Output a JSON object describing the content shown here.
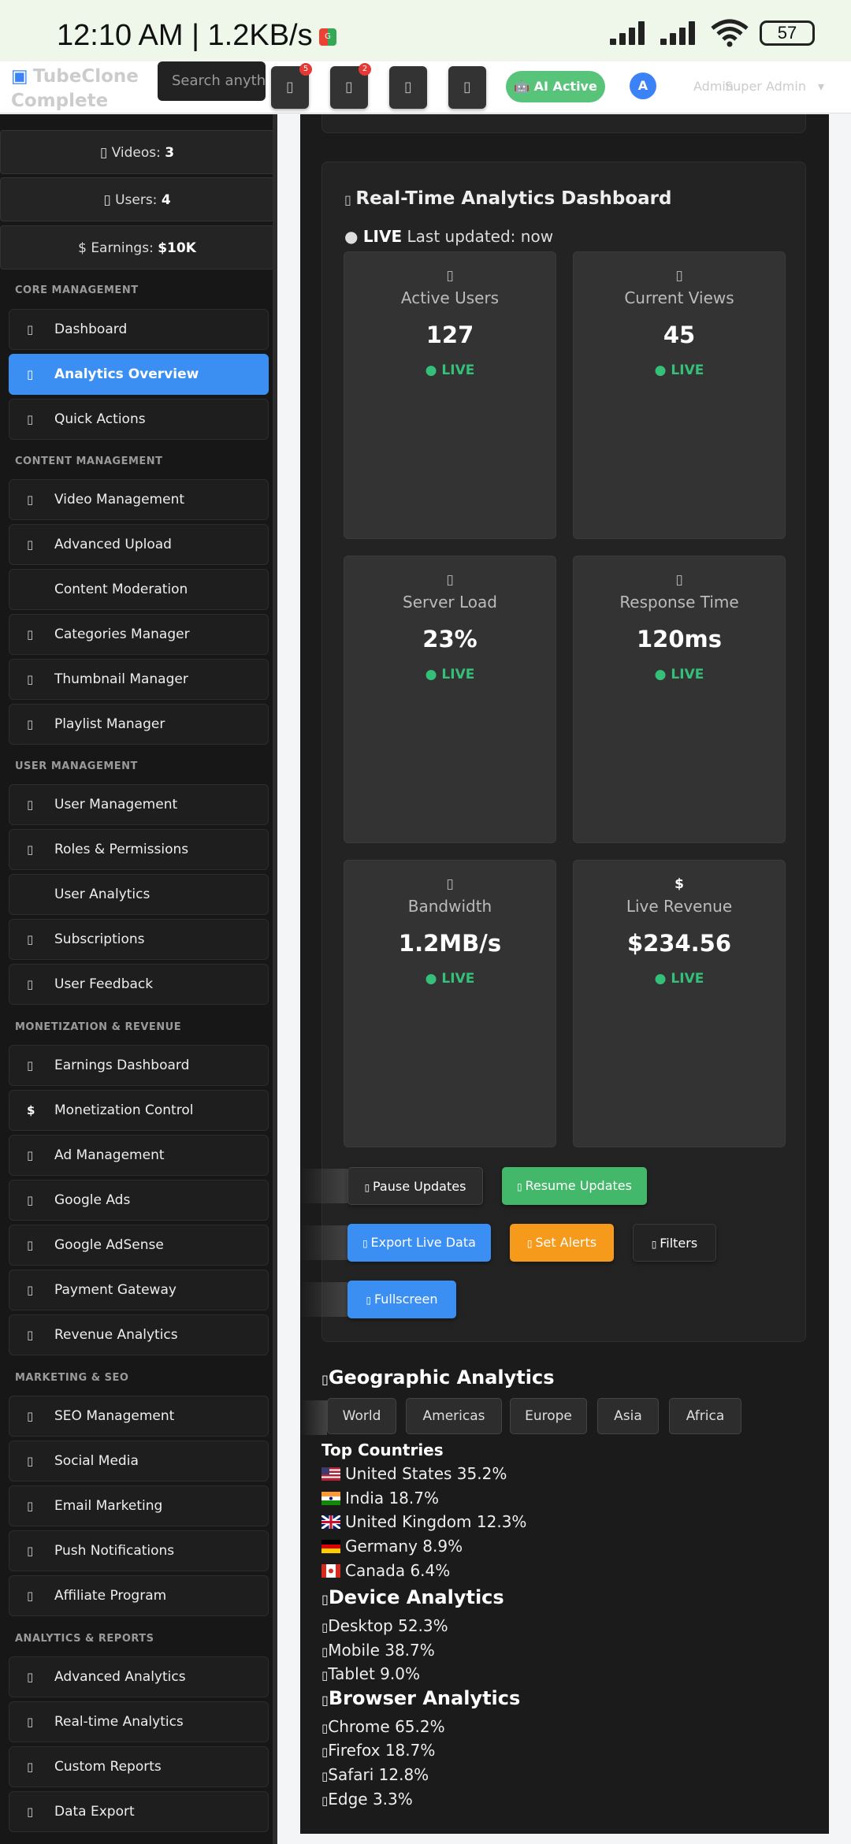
{
  "status_bar": {
    "time": "12:10 AM | 1.2KB/s",
    "battery": "57"
  },
  "header": {
    "brand": "TubeClone Complete Admin",
    "search_placeholder": "Search anything...",
    "notification_badge_1": "5",
    "notification_badge_2": "2",
    "ai_status": "🤖 AI Active",
    "avatar_initial": "A",
    "admin_label": "Admin",
    "admin_role": "Super Admin"
  },
  "sidebar": {
    "stats": [
      {
        "label": "Videos: ",
        "value": "3"
      },
      {
        "label": "Users: ",
        "value": "4"
      },
      {
        "label": "$ Earnings: ",
        "value": "$10K"
      }
    ],
    "sections": [
      {
        "title": "CORE MANAGEMENT",
        "items": [
          "Dashboard",
          "Analytics Overview",
          "Quick Actions"
        ]
      },
      {
        "title": "CONTENT MANAGEMENT",
        "items": [
          "Video Management",
          "Advanced Upload",
          "Content Moderation",
          "Categories Manager",
          "Thumbnail Manager",
          "Playlist Manager"
        ]
      },
      {
        "title": "USER MANAGEMENT",
        "items": [
          "User Management",
          "Roles & Permissions",
          "User Analytics",
          "Subscriptions",
          "User Feedback"
        ]
      },
      {
        "title": "MONETIZATION & REVENUE",
        "items": [
          "Earnings Dashboard",
          "Monetization Control",
          "Ad Management",
          "Google Ads",
          "Google AdSense",
          "Payment Gateway",
          "Revenue Analytics"
        ]
      },
      {
        "title": "MARKETING & SEO",
        "items": [
          "SEO Management",
          "Social Media",
          "Email Marketing",
          "Push Notifications",
          "Affiliate Program"
        ]
      },
      {
        "title": "ANALYTICS & REPORTS",
        "items": [
          "Advanced Analytics",
          "Real-time Analytics",
          "Custom Reports",
          "Data Export"
        ]
      }
    ],
    "active_item": "Analytics Overview"
  },
  "dashboard": {
    "title": "Real-Time Analytics Dashboard",
    "live_label": "LIVE",
    "updated_text": " Last updated: now",
    "metrics": [
      {
        "label": "Active Users",
        "value": "127",
        "status": "● LIVE"
      },
      {
        "label": "Current Views",
        "value": "45",
        "status": "● LIVE"
      },
      {
        "label": "Server Load",
        "value": "23%",
        "status": "● LIVE"
      },
      {
        "label": "Response Time",
        "value": "120ms",
        "status": "● LIVE"
      },
      {
        "label": "Bandwidth",
        "value": "1.2MB/s",
        "status": "● LIVE"
      },
      {
        "label": "Live Revenue",
        "value": "$234.56",
        "status": "● LIVE"
      }
    ],
    "buttons": {
      "pause": "Pause Updates",
      "resume": "Resume Updates",
      "export": "Export Live Data",
      "alerts": "Set Alerts",
      "filters": "Filters",
      "fullscreen": "Fullscreen"
    }
  },
  "geographic": {
    "title": "Geographic Analytics",
    "regions": [
      "World",
      "Americas",
      "Europe",
      "Asia",
      "Africa"
    ],
    "top_countries_label": "Top Countries",
    "countries": [
      {
        "name": "United States 35.2%"
      },
      {
        "name": "India 18.7%"
      },
      {
        "name": "United Kingdom 12.3%"
      },
      {
        "name": "Germany 8.9%"
      },
      {
        "name": "Canada 6.4%"
      }
    ]
  },
  "device": {
    "title": "Device Analytics",
    "items": [
      "Desktop 52.3%",
      "Mobile 38.7%",
      "Tablet 9.0%"
    ]
  },
  "browser": {
    "title": "Browser Analytics",
    "items": [
      "Chrome 65.2%",
      "Firefox 18.7%",
      "Safari 12.8%",
      "Edge 3.3%"
    ]
  },
  "colors": {
    "accent": "#3b8ff2",
    "live_green": "#35c07a",
    "resume_green": "#44b86a",
    "alert_orange": "#f59a1a"
  }
}
